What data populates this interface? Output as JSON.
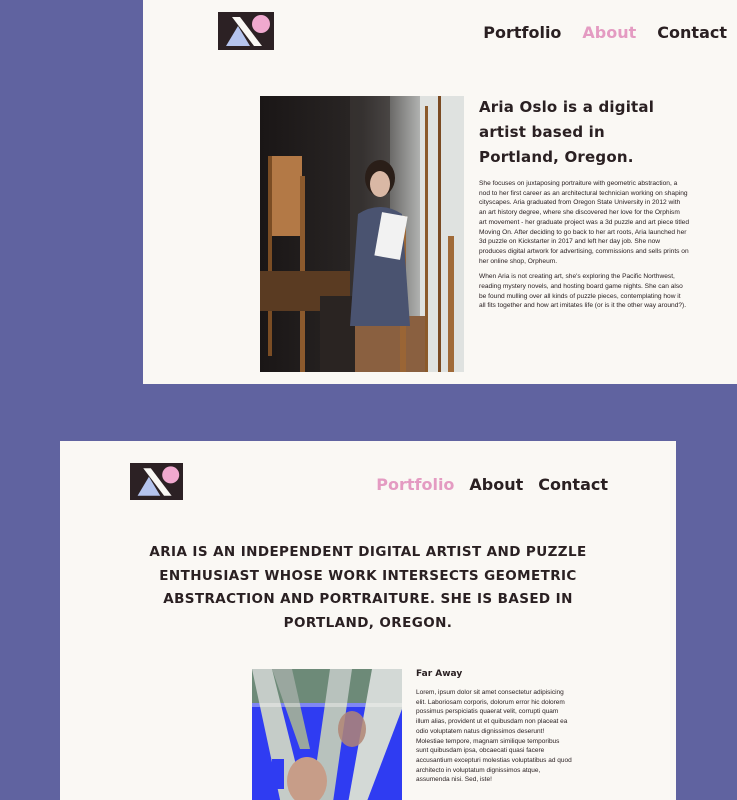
{
  "top_page": {
    "nav": {
      "items": [
        {
          "label": "Portfolio"
        },
        {
          "label": "About"
        },
        {
          "label": "Contact"
        }
      ],
      "active": "About"
    },
    "bio": {
      "heading": "Aria Oslo is a digital artist based in Portland, Oregon.",
      "paragraph1": "She focuses on juxtaposing portraiture with geometric abstraction, a nod to her first career as an architectural technician working on shaping cityscapes. Aria graduated from Oregon State University in 2012 with an art history degree, where she discovered her love for the Orphism art movement - her graduate project was a 3d puzzle and art piece titled Moving On. After deciding to go back to her art roots, Aria launched her 3d puzzle on Kickstarter in 2017 and left her day job. She now produces digital artwork for advertising, commissions and sells prints on her online shop, Orpheum.",
      "paragraph2": "When Aria is not creating art, she's exploring the Pacific Northwest, reading mystery novels, and hosting board game nights. She can also be found mulling over all kinds of puzzle pieces, contemplating how it all fits together and how art imitates life (or is it the other way around?)."
    }
  },
  "bottom_page": {
    "nav": {
      "items": [
        {
          "label": "Portfolio"
        },
        {
          "label": "About"
        },
        {
          "label": "Contact"
        }
      ],
      "active": "Portfolio"
    },
    "tagline": "Aria is an independent digital artist and puzzle enthusiast whose work intersects geometric abstraction and portraiture. She is based in Portland, Oregon.",
    "work": {
      "title": "Far Away",
      "description": "Lorem, ipsum dolor sit amet consectetur adipisicing elit. Laboriosam corporis, dolorum error hic dolorem possimus perspiciatis quaerat velit, corrupti quam illum alias, provident ut et quibusdam non placeat ea odio voluptatem natus dignissimos deserunt! Molestiae tempore, magnam similique temporibus sunt quibusdam ipsa, obcaecati quasi facere accusantium excepturi molestias voluptatibus ad quod architecto in voluptatum dignissimos atque, assumenda nisi. Sed, iste!"
    }
  },
  "colors": {
    "background": "#6063a0",
    "card": "#faf8f4",
    "text": "#2a2022",
    "accent_pink": "#e49bc2",
    "logo_dark": "#2c2124",
    "logo_blue": "#b5c4ee",
    "art_blue": "#2f3cf2"
  },
  "icons": {
    "logo": "geometric-logo-icon"
  }
}
